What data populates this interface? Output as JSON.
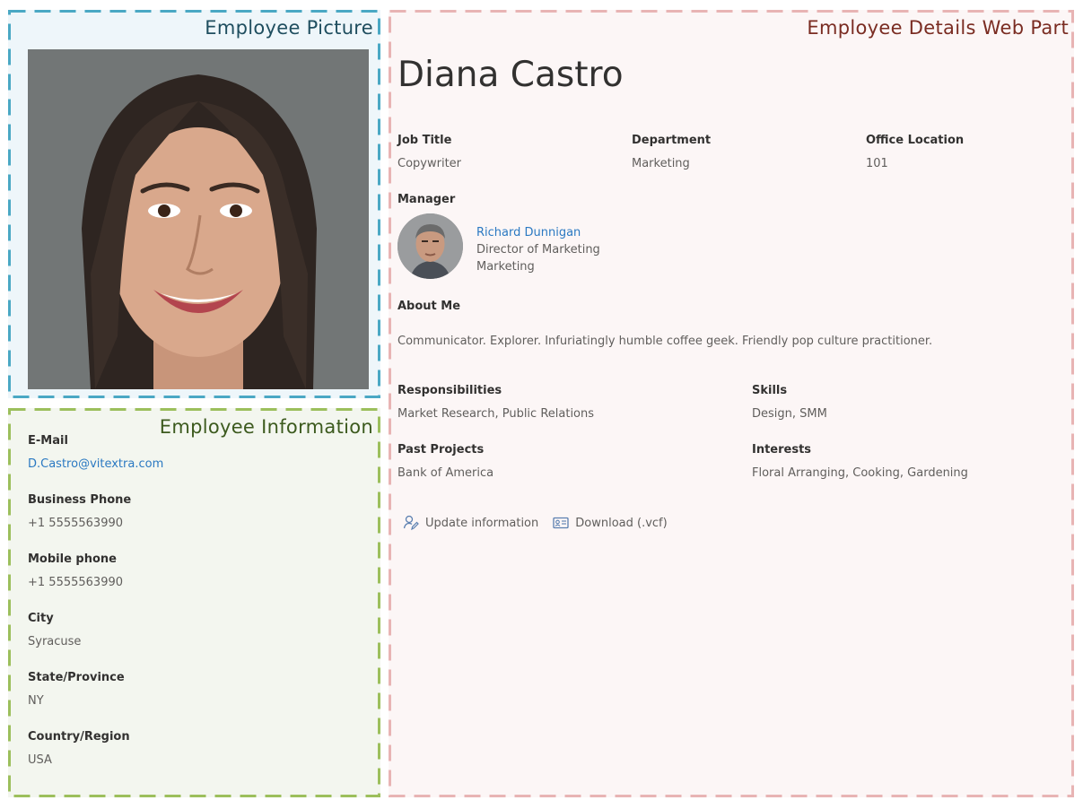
{
  "picture_panel": {
    "title": "Employee Picture",
    "photo_alt": "employee-portrait"
  },
  "info_panel": {
    "title": "Employee Information",
    "items": [
      {
        "label": "E-Mail",
        "value": "D.Castro@vitextra.com",
        "is_link": true
      },
      {
        "label": "Business Phone",
        "value": "+1 5555563990"
      },
      {
        "label": "Mobile phone",
        "value": "+1 5555563990"
      },
      {
        "label": "City",
        "value": "Syracuse"
      },
      {
        "label": "State/Province",
        "value": "NY"
      },
      {
        "label": "Country/Region",
        "value": "USA"
      }
    ]
  },
  "details_panel": {
    "title": "Employee Details Web Part",
    "name": "Diana Castro",
    "job_title": {
      "label": "Job Title",
      "value": "Copywriter"
    },
    "department": {
      "label": "Department",
      "value": "Marketing"
    },
    "office_location": {
      "label": "Office Location",
      "value": "101"
    },
    "manager": {
      "label": "Manager",
      "name": "Richard Dunnigan",
      "title": "Director of Marketing",
      "department": "Marketing"
    },
    "about": {
      "label": "About Me",
      "value": "Communicator. Explorer. Infuriatingly humble coffee geek. Friendly pop culture practitioner."
    },
    "responsibilities": {
      "label": "Responsibilities",
      "value": "Market Research, Public Relations"
    },
    "skills": {
      "label": "Skills",
      "value": "Design, SMM"
    },
    "past_projects": {
      "label": "Past Projects",
      "value": "Bank of America"
    },
    "interests": {
      "label": "Interests",
      "value": "Floral Arranging, Cooking, Gardening"
    },
    "actions": {
      "update": {
        "label": "Update information",
        "icon": "person-edit-icon"
      },
      "download": {
        "label": "Download (.vcf)",
        "icon": "contact-card-icon"
      }
    }
  },
  "colors": {
    "picture_border": "#4aa8c4",
    "info_border": "#9cbf5c",
    "details_border": "#e8b4b4",
    "link": "#2b79c2"
  }
}
